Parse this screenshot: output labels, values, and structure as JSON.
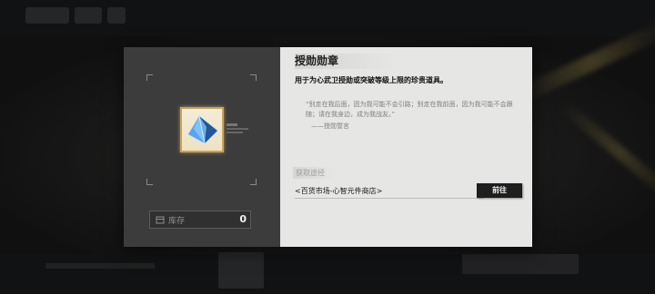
{
  "item": {
    "name": "授勋勋章",
    "description": "用于为心武卫授勋或突破等级上限的珍贵道具。",
    "quote": "“别走在我后面，因为我可能不会引路；别走在我前面，因为我可能不会跟随；请在我身边，成为我战友。”",
    "quote_source": "——授勋誓言",
    "icon": "diamond-gem-icon",
    "stock_label": "库存",
    "stock_count": "0"
  },
  "acquisition": {
    "label": "获取途径",
    "source": "<百货市场-心智元件商店>",
    "go_button": "前往"
  },
  "colors": {
    "dialog_left": "#3c3c3d",
    "dialog_right": "#e6e6e5",
    "tile_border": "#c9a45b",
    "gem": "#4a8fd6",
    "button": "#1e1e1e"
  }
}
